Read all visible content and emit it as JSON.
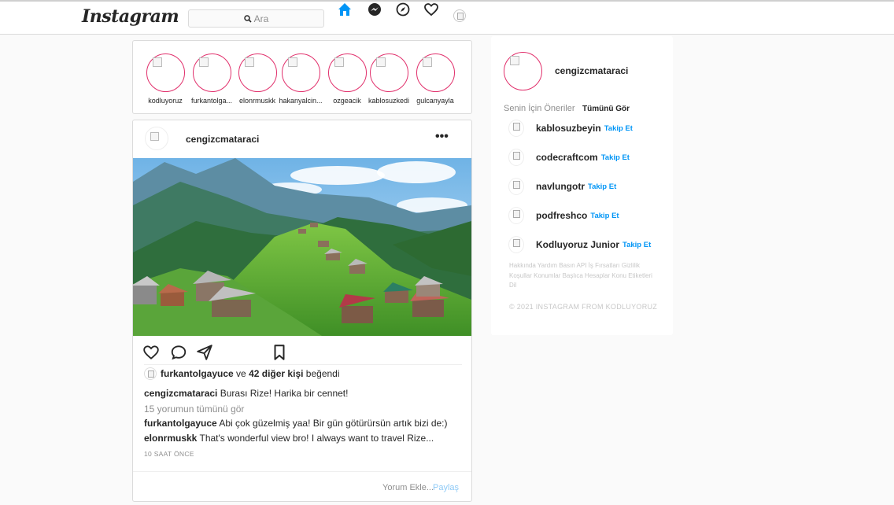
{
  "header": {
    "logo": "Instagram",
    "search_placeholder": "Ara"
  },
  "stories": [
    {
      "name": "kodluyoruz"
    },
    {
      "name": "furkantolga..."
    },
    {
      "name": "elonrmuskk"
    },
    {
      "name": "hakanyalcin..."
    },
    {
      "name": "ozgeacik"
    },
    {
      "name": "kablosuzkedi"
    },
    {
      "name": "gulcanyayla"
    }
  ],
  "post": {
    "username": "cengizcmataraci",
    "more_label": "•••",
    "likes": {
      "user": "furkantolgayuce",
      "and_text": "ve",
      "others": "42 diğer kişi",
      "liked_text": "beğendi"
    },
    "caption": {
      "user": "cengizcmataraci",
      "text": "Burası Rize! Harika bir cennet!"
    },
    "view_comments": "15 yorumun tümünü gör",
    "comments": [
      {
        "user": "furkantolgayuce",
        "text": "Abi çok güzelmiş yaa! Bir gün götürürsün artık bizi de:)"
      },
      {
        "user": "elonrmuskk",
        "text": "That's wonderful view bro! I always want to travel Rize..."
      }
    ],
    "time": "10 SAAT ÖNCE",
    "add_comment_placeholder": "Yorum Ekle...",
    "share_label": "Paylaş"
  },
  "sidebar": {
    "username": "cengizcmataraci",
    "suggestions_title": "Senin İçin Öneriler",
    "see_all": "Tümünü Gör",
    "follow_label": "Takip Et",
    "suggestions": [
      {
        "name": "kablosuzbeyin"
      },
      {
        "name": "codecraftcom"
      },
      {
        "name": "navlungotr"
      },
      {
        "name": "podfreshco"
      },
      {
        "name": "Kodluyoruz Junior"
      }
    ],
    "footer_links": "Hakkında Yardım Basın API İş Fırsatları Gizlilik Koşullar Konumlar Başlıca Hesaplar Konu Etiketleri Dil",
    "copyright": "© 2021 INSTAGRAM FROM KODLUYORUZ"
  }
}
